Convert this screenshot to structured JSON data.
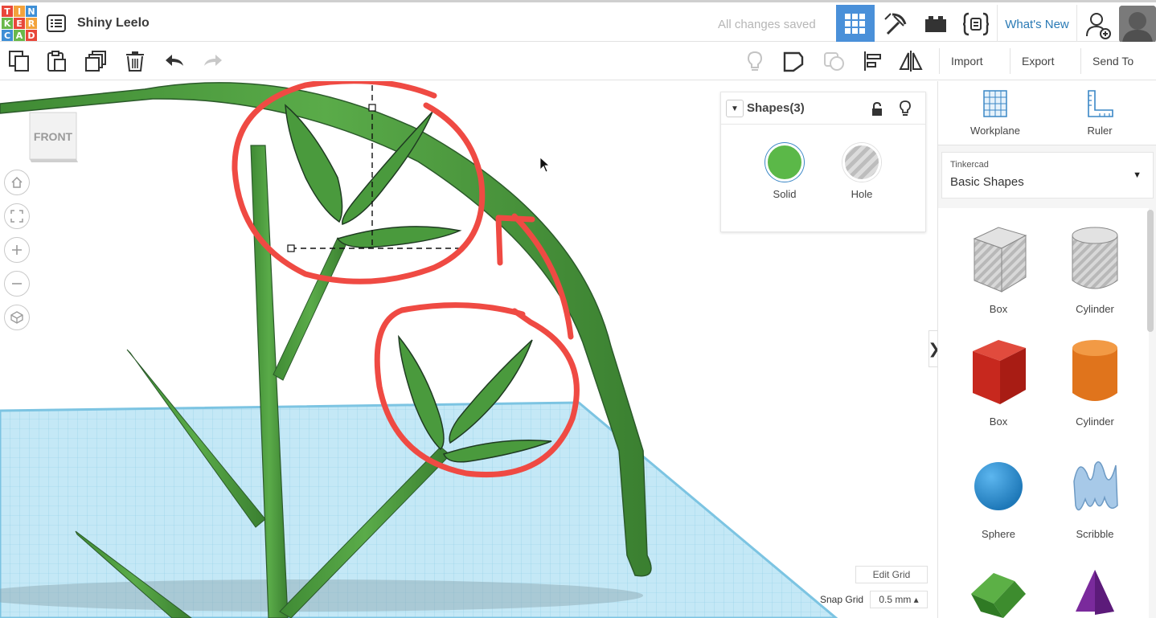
{
  "header": {
    "logo_letters": [
      "T",
      "I",
      "N",
      "K",
      "E",
      "R",
      "C",
      "A",
      "D"
    ],
    "logo_colors": [
      "#e8473a",
      "#f3a23c",
      "#3f8fd5",
      "#69b84a",
      "#e8473a",
      "#f3a23c",
      "#3f8fd5",
      "#69b84a",
      "#e8473a"
    ],
    "design_name": "Shiny Leelo",
    "save_status": "All changes saved",
    "whats_new": "What's New",
    "buttons": [
      "grid-view-icon",
      "pickaxe-icon",
      "briefcase-icon",
      "code-blocks-icon"
    ]
  },
  "toolbar": {
    "import_label": "Import",
    "export_label": "Export",
    "send_to_label": "Send To",
    "icons": [
      "copy-icon",
      "paste-icon",
      "duplicate-icon",
      "trash-icon",
      "undo-icon",
      "redo-icon",
      "lightbulb-icon",
      "note-icon",
      "chat-icon",
      "align-icon",
      "mirror-icon"
    ]
  },
  "viewport": {
    "view_cube_label": "FRONT",
    "nav_buttons": [
      "home-icon",
      "fit-view-icon",
      "zoom-in-icon",
      "zoom-out-icon",
      "perspective-icon"
    ],
    "edit_grid_label": "Edit Grid",
    "snap_grid_label": "Snap Grid",
    "snap_grid_value": "0.5 mm ▴",
    "colors": {
      "plant": "#4a9a3d",
      "annotation": "#ef4a43",
      "grid": "#a8dcf0"
    }
  },
  "shapes_panel": {
    "title": "Shapes(3)",
    "solid_label": "Solid",
    "hole_label": "Hole",
    "solid_color": "#5bb848"
  },
  "sidebar": {
    "workplane_label": "Workplane",
    "ruler_label": "Ruler",
    "library_small": "Tinkercad",
    "library_name": "Basic Shapes",
    "shapes": [
      {
        "name": "Box"
      },
      {
        "name": "Cylinder"
      },
      {
        "name": "Box"
      },
      {
        "name": "Cylinder"
      },
      {
        "name": "Sphere"
      },
      {
        "name": "Scribble"
      }
    ]
  }
}
